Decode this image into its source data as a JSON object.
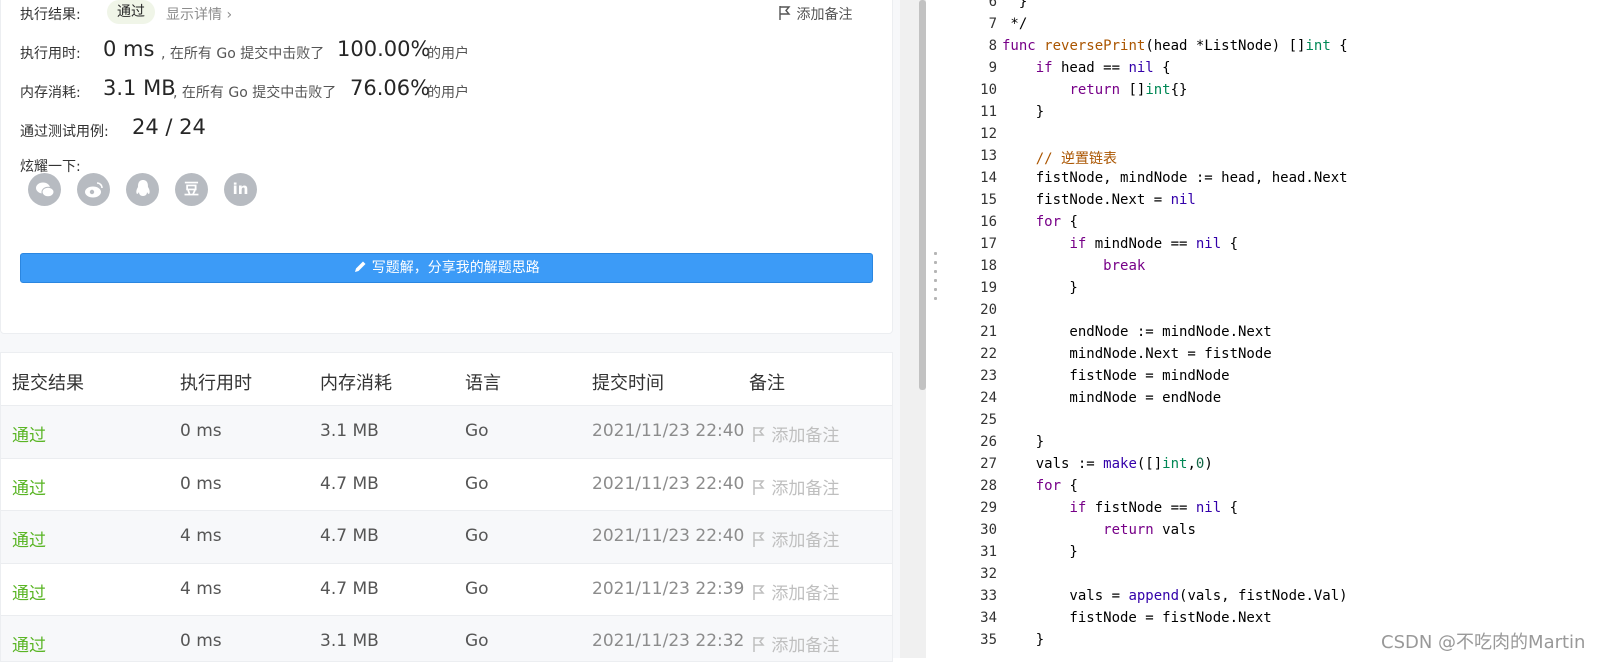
{
  "result": {
    "status_label": "执行结果:",
    "status_value": "通过",
    "detail_link": "显示详情 ›",
    "add_note": "添加备注",
    "runtime_label": "执行用时:",
    "runtime_value": "0 ms",
    "runtime_mid": ", 在所有 Go 提交中击败了",
    "runtime_pct": "100.00%",
    "runtime_tail": "的用户",
    "memory_label": "内存消耗:",
    "memory_value": "3.1 MB",
    "memory_mid": ", 在所有 Go 提交中击败了",
    "memory_pct": "76.06%",
    "memory_tail": "的用户",
    "tests_label": "通过测试用例:",
    "tests_value": "24 / 24",
    "share_label": "炫耀一下:",
    "share_icons": [
      "wechat-icon",
      "weibo-icon",
      "qq-icon",
      "douban-icon",
      "linkedin-icon"
    ],
    "douban_glyph": "豆",
    "linkedin_glyph": "in",
    "write_button": "写题解，分享我的解题思路"
  },
  "submissions": {
    "headers": [
      "提交结果",
      "执行用时",
      "内存消耗",
      "语言",
      "提交时间",
      "备注"
    ],
    "rows": [
      {
        "result": "通过",
        "runtime": "0 ms",
        "memory": "3.1 MB",
        "lang": "Go",
        "time": "2021/11/23 22:40",
        "note": "添加备注"
      },
      {
        "result": "通过",
        "runtime": "0 ms",
        "memory": "4.7 MB",
        "lang": "Go",
        "time": "2021/11/23 22:40",
        "note": "添加备注"
      },
      {
        "result": "通过",
        "runtime": "4 ms",
        "memory": "4.7 MB",
        "lang": "Go",
        "time": "2021/11/23 22:40",
        "note": "添加备注"
      },
      {
        "result": "通过",
        "runtime": "4 ms",
        "memory": "4.7 MB",
        "lang": "Go",
        "time": "2021/11/23 22:39",
        "note": "添加备注"
      },
      {
        "result": "通过",
        "runtime": "0 ms",
        "memory": "3.1 MB",
        "lang": "Go",
        "time": "2021/11/23 22:32",
        "note": "添加备注"
      }
    ]
  },
  "editor": {
    "lines": [
      {
        "n": "6",
        "code": "  }"
      },
      {
        "n": "7",
        "code": " */"
      },
      {
        "n": "8",
        "code": "func reversePrint(head *ListNode) []int {"
      },
      {
        "n": "9",
        "code": "    if head == nil {"
      },
      {
        "n": "10",
        "code": "        return []int{}"
      },
      {
        "n": "11",
        "code": "    }"
      },
      {
        "n": "12",
        "code": ""
      },
      {
        "n": "13",
        "code": "    // 逆置链表"
      },
      {
        "n": "14",
        "code": "    fistNode, mindNode := head, head.Next"
      },
      {
        "n": "15",
        "code": "    fistNode.Next = nil"
      },
      {
        "n": "16",
        "code": "    for {"
      },
      {
        "n": "17",
        "code": "        if mindNode == nil {"
      },
      {
        "n": "18",
        "code": "            break"
      },
      {
        "n": "19",
        "code": "        }"
      },
      {
        "n": "20",
        "code": ""
      },
      {
        "n": "21",
        "code": "        endNode := mindNode.Next"
      },
      {
        "n": "22",
        "code": "        mindNode.Next = fistNode"
      },
      {
        "n": "23",
        "code": "        fistNode = mindNode"
      },
      {
        "n": "24",
        "code": "        mindNode = endNode"
      },
      {
        "n": "25",
        "code": ""
      },
      {
        "n": "26",
        "code": "    }"
      },
      {
        "n": "27",
        "code": "    vals := make([]int,0)"
      },
      {
        "n": "28",
        "code": "    for {"
      },
      {
        "n": "29",
        "code": "        if fistNode == nil {"
      },
      {
        "n": "30",
        "code": "            return vals"
      },
      {
        "n": "31",
        "code": "        }"
      },
      {
        "n": "32",
        "code": ""
      },
      {
        "n": "33",
        "code": "        vals = append(vals, fistNode.Val)"
      },
      {
        "n": "34",
        "code": "        fistNode = fistNode.Next"
      },
      {
        "n": "35",
        "code": "    }"
      }
    ]
  },
  "watermark": "CSDN @不吃肉的Martin",
  "colors": {
    "accent_blue": "#3c9bf7",
    "pass_green": "#5ab525",
    "keyword": "#770088",
    "type": "#008855",
    "builtin": "#3300aa",
    "comment": "#aa5500",
    "number": "#116644"
  }
}
